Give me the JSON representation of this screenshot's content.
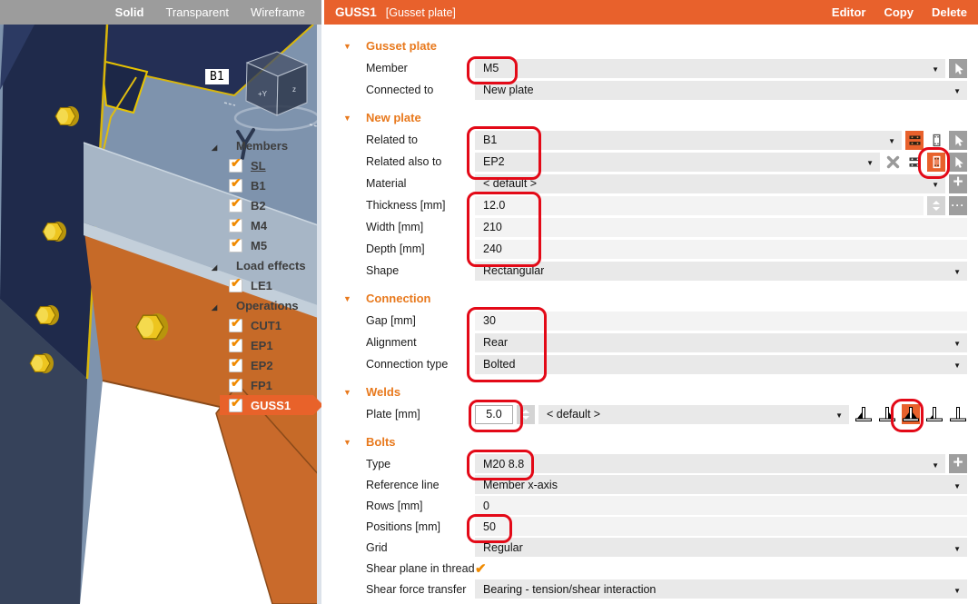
{
  "view_toolbar": {
    "solid": "Solid",
    "transparent": "Transparent",
    "wireframe": "Wireframe"
  },
  "header": {
    "title": "GUSS1",
    "subtitle": "[Gusset plate]",
    "editor": "Editor",
    "copy": "Copy",
    "delete": "Delete"
  },
  "viewport": {
    "member_tag": "B1",
    "cube": {
      "front": "+Y",
      "side": "z"
    },
    "tree": {
      "members": {
        "label": "Members",
        "sl": "SL",
        "b1": "B1",
        "b2": "B2",
        "m4": "M4",
        "m5": "M5"
      },
      "load_effects": {
        "label": "Load effects",
        "le1": "LE1"
      },
      "operations": {
        "label": "Operations",
        "cut1": "CUT1",
        "ep1": "EP1",
        "ep2": "EP2",
        "fp1": "FP1",
        "guss1": "GUSS1"
      }
    }
  },
  "panel": {
    "gusset_plate": {
      "title": "Gusset plate",
      "member": {
        "label": "Member",
        "value": "M5"
      },
      "connected_to": {
        "label": "Connected to",
        "value": "New plate"
      }
    },
    "new_plate": {
      "title": "New plate",
      "related_to": {
        "label": "Related to",
        "value": "B1"
      },
      "related_also_to": {
        "label": "Related also to",
        "value": "EP2"
      },
      "material": {
        "label": "Material",
        "value": "< default >"
      },
      "thickness": {
        "label": "Thickness [mm]",
        "value": "12.0"
      },
      "width": {
        "label": "Width [mm]",
        "value": "210"
      },
      "depth": {
        "label": "Depth [mm]",
        "value": "240"
      },
      "shape": {
        "label": "Shape",
        "value": "Rectangular"
      }
    },
    "connection": {
      "title": "Connection",
      "gap": {
        "label": "Gap [mm]",
        "value": "30"
      },
      "alignment": {
        "label": "Alignment",
        "value": "Rear"
      },
      "connection_type": {
        "label": "Connection type",
        "value": "Bolted"
      }
    },
    "welds": {
      "title": "Welds",
      "plate": {
        "label": "Plate [mm]",
        "value": "5.0",
        "throat_value": "< default >"
      }
    },
    "bolts": {
      "title": "Bolts",
      "type": {
        "label": "Type",
        "value": "M20 8.8"
      },
      "reference_line": {
        "label": "Reference line",
        "value": "Member x-axis"
      },
      "rows": {
        "label": "Rows [mm]",
        "value": "0"
      },
      "positions": {
        "label": "Positions [mm]",
        "value": "50"
      },
      "grid": {
        "label": "Grid",
        "value": "Regular"
      },
      "shear_plane": {
        "label": "Shear plane in thread",
        "checked": true
      },
      "shear_force": {
        "label": "Shear force transfer",
        "value": "Bearing - tension/shear interaction"
      }
    }
  },
  "colors": {
    "accent_orange": "#E8612C",
    "heading_orange": "#E8791D",
    "annotation_red": "#E30917",
    "viewport_background": "#7E93AD",
    "bolt_yellow": "#EDC51F",
    "plate_orange": "#C66A28",
    "column_navy": "#1F2A4B"
  }
}
